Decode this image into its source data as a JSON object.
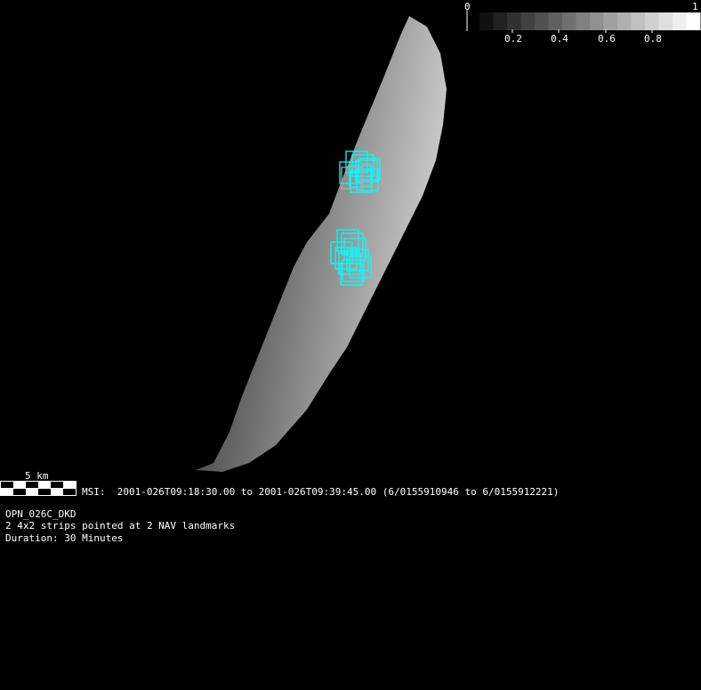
{
  "colorbar": {
    "min_label": "0",
    "max_label": "1",
    "ticks": [
      "0.2",
      "0.4",
      "0.6",
      "0.8"
    ],
    "steps": 16
  },
  "scale_bar": {
    "label": "5 km"
  },
  "observation": {
    "msi_line": "MSI:  2001-026T09:18:30.00 to 2001-026T09:39:45.00 (6/0155910946 to 6/0155912221)",
    "plan_name": "OPN_026C_DKD",
    "description": "2 4x2 strips pointed at 2 NAV landmarks",
    "duration": "Duration: 30 Minutes"
  },
  "colors": {
    "footprint": "#00ffff",
    "footprint_alt": "#aaaaaa"
  }
}
